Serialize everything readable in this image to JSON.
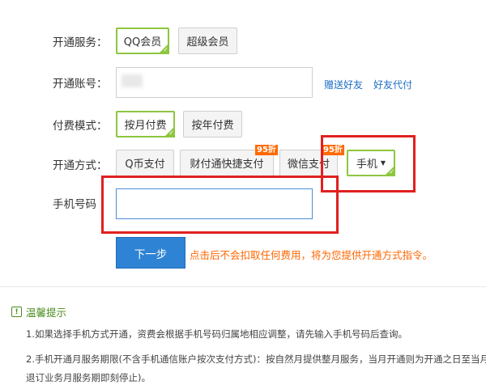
{
  "form": {
    "service_label": "开通服务：",
    "service_options": [
      "QQ会员",
      "超级会员"
    ],
    "account_label": "开通账号：",
    "account_links": [
      "赠送好友",
      "好友代付"
    ],
    "billing_label": "付费模式：",
    "billing_options": [
      "按月付费",
      "按年付费"
    ],
    "method_label": "开通方式：",
    "method_options": [
      "Q币支付",
      "财付通快捷支付",
      "微信支付",
      "手机"
    ],
    "badge_95": "95折",
    "phone_label": "手机号码",
    "phone_placeholder": "",
    "next_button": "下一步",
    "next_hint": "点击后不会扣取任何费用，将为您提供开通方式指令。"
  },
  "tips": {
    "title": "温馨提示",
    "lines": [
      "1.如果选择手机方式开通，资费会根据手机号码归属地相应调整，请先输入手机号码后查询。",
      "2.手机开通月服务期限(不含手机通信账户按次支付方式)：按自然月提供整月服务，当月开通则为开通之日至当月",
      "退订业务月服务期即刻停止)。"
    ]
  },
  "icons": {
    "selected_check": "check-icon",
    "dropdown": "caret-down-icon",
    "tip": "exclamation-icon"
  },
  "colors": {
    "selected_border": "#8dc63f",
    "highlight_box": "#e02020",
    "primary_button": "#2e83d4",
    "hint_text": "#ff6600",
    "badge": "#ff6a00"
  }
}
